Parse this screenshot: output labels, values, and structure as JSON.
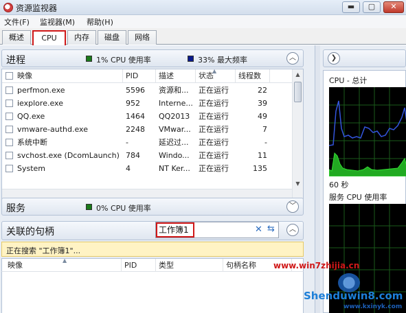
{
  "window": {
    "title": "资源监视器",
    "min_glyph": "▬",
    "max_glyph": "▢",
    "close_glyph": "✕"
  },
  "menu": [
    "文件(F)",
    "监视器(M)",
    "帮助(H)"
  ],
  "tabs": [
    {
      "label": "概述",
      "active": false
    },
    {
      "label": "CPU",
      "active": true
    },
    {
      "label": "内存",
      "active": false
    },
    {
      "label": "磁盘",
      "active": false
    },
    {
      "label": "网络",
      "active": false
    }
  ],
  "processes": {
    "title": "进程",
    "cpu_usage": "1% CPU 使用率",
    "max_freq": "33% 最大频率",
    "cpu_color": "#1a7a1a",
    "freq_color": "#0a1a8c",
    "columns": [
      "映像",
      "PID",
      "描述",
      "状态",
      "线程数"
    ],
    "rows": [
      [
        "perfmon.exe",
        "5596",
        "资源和...",
        "正在运行",
        "22"
      ],
      [
        "iexplore.exe",
        "952",
        "Interne...",
        "正在运行",
        "39"
      ],
      [
        "QQ.exe",
        "1464",
        "QQ2013",
        "正在运行",
        "49"
      ],
      [
        "vmware-authd.exe",
        "2248",
        "VMwar...",
        "正在运行",
        "7"
      ],
      [
        "系统中断",
        "-",
        "延迟过...",
        "正在运行",
        "-"
      ],
      [
        "svchost.exe (DcomLaunch)",
        "784",
        "Windo...",
        "正在运行",
        "11"
      ],
      [
        "System",
        "4",
        "NT Ker...",
        "正在运行",
        "135"
      ]
    ]
  },
  "services": {
    "title": "服务",
    "cpu_usage": "0% CPU 使用率"
  },
  "handles": {
    "title": "关联的句柄",
    "search_value": "工作簿1",
    "status": "正在搜索 \"工作簿1\"...",
    "columns": [
      "映像",
      "PID",
      "类型",
      "句柄名称"
    ]
  },
  "right_panel": {
    "cpu_total": "CPU - 总计",
    "duration": "60 秒",
    "service_cpu": "服务 CPU 使用率"
  },
  "watermarks": {
    "site1": "www.win7zhijia.cn",
    "site2": "Shenduwin8.com",
    "site3": "www.kxinyk.com"
  }
}
